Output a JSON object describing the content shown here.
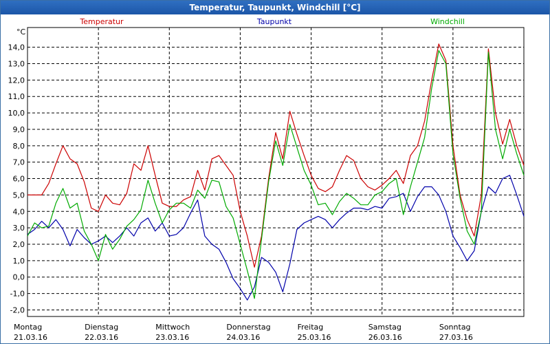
{
  "window": {
    "title": "Temperatur, Taupunkt, Windchill [°C]"
  },
  "chart_data": {
    "type": "line",
    "title": "Temperatur, Taupunkt, Windchill [°C]",
    "ylabel": "°C",
    "ylim": [
      -2.4,
      15.2
    ],
    "yticks": [
      -2.0,
      -1.0,
      0.0,
      1.0,
      2.0,
      3.0,
      4.0,
      5.0,
      6.0,
      7.0,
      8.0,
      9.0,
      10.0,
      11.0,
      12.0,
      13.0,
      14.0
    ],
    "ytick_labels": [
      "-2,0",
      "-1,0",
      "0,0",
      "1,0",
      "2,0",
      "3,0",
      "4,0",
      "5,0",
      "6,0",
      "7,0",
      "8,0",
      "9,0",
      "10,0",
      "11,0",
      "12,0",
      "13,0",
      "14,0"
    ],
    "xlim": [
      0,
      7
    ],
    "x_ticks": [
      {
        "day": "Montag",
        "date": "21.03.16"
      },
      {
        "day": "Dienstag",
        "date": "22.03.16"
      },
      {
        "day": "Mittwoch",
        "date": "23.03.16"
      },
      {
        "day": "Donnerstag",
        "date": "24.03.16"
      },
      {
        "day": "Freitag",
        "date": "25.03.16"
      },
      {
        "day": "Samstag",
        "date": "26.03.16"
      },
      {
        "day": "Sonntag",
        "date": "27.03.16"
      }
    ],
    "grid": true,
    "legend_position": "top",
    "series": [
      {
        "name": "Temperatur",
        "color": "#cc0000",
        "points": [
          [
            0.0,
            5.0
          ],
          [
            0.1,
            5.0
          ],
          [
            0.2,
            5.0
          ],
          [
            0.3,
            5.7
          ],
          [
            0.4,
            6.9
          ],
          [
            0.5,
            8.0
          ],
          [
            0.6,
            7.2
          ],
          [
            0.7,
            6.9
          ],
          [
            0.8,
            5.8
          ],
          [
            0.9,
            4.2
          ],
          [
            1.0,
            4.0
          ],
          [
            1.1,
            5.0
          ],
          [
            1.2,
            4.5
          ],
          [
            1.3,
            4.4
          ],
          [
            1.4,
            5.1
          ],
          [
            1.5,
            6.9
          ],
          [
            1.6,
            6.5
          ],
          [
            1.7,
            8.0
          ],
          [
            1.8,
            6.2
          ],
          [
            1.9,
            4.5
          ],
          [
            2.0,
            4.3
          ],
          [
            2.1,
            4.3
          ],
          [
            2.2,
            4.7
          ],
          [
            2.3,
            4.9
          ],
          [
            2.4,
            6.5
          ],
          [
            2.5,
            5.3
          ],
          [
            2.6,
            7.2
          ],
          [
            2.7,
            7.4
          ],
          [
            2.8,
            6.8
          ],
          [
            2.9,
            6.2
          ],
          [
            3.0,
            4.0
          ],
          [
            3.1,
            2.5
          ],
          [
            3.2,
            0.6
          ],
          [
            3.3,
            2.5
          ],
          [
            3.4,
            6.0
          ],
          [
            3.5,
            8.8
          ],
          [
            3.6,
            7.2
          ],
          [
            3.7,
            10.1
          ],
          [
            3.8,
            8.7
          ],
          [
            3.9,
            7.4
          ],
          [
            4.0,
            6.2
          ],
          [
            4.1,
            5.4
          ],
          [
            4.2,
            5.2
          ],
          [
            4.3,
            5.5
          ],
          [
            4.4,
            6.5
          ],
          [
            4.5,
            7.4
          ],
          [
            4.6,
            7.1
          ],
          [
            4.7,
            6.0
          ],
          [
            4.8,
            5.5
          ],
          [
            4.9,
            5.3
          ],
          [
            5.0,
            5.6
          ],
          [
            5.1,
            6.0
          ],
          [
            5.2,
            6.5
          ],
          [
            5.3,
            5.7
          ],
          [
            5.4,
            7.4
          ],
          [
            5.5,
            8.0
          ],
          [
            5.6,
            9.5
          ],
          [
            5.7,
            12.0
          ],
          [
            5.8,
            14.2
          ],
          [
            5.9,
            13.2
          ],
          [
            6.0,
            8.0
          ],
          [
            6.1,
            5.0
          ],
          [
            6.2,
            3.5
          ],
          [
            6.3,
            2.5
          ],
          [
            6.4,
            5.0
          ],
          [
            6.5,
            13.9
          ],
          [
            6.6,
            10.0
          ],
          [
            6.7,
            8.1
          ],
          [
            6.8,
            9.6
          ],
          [
            6.9,
            8.0
          ],
          [
            7.0,
            6.8
          ]
        ]
      },
      {
        "name": "Taupunkt",
        "color": "#0000aa",
        "points": [
          [
            0.0,
            2.6
          ],
          [
            0.1,
            2.9
          ],
          [
            0.2,
            3.4
          ],
          [
            0.3,
            3.0
          ],
          [
            0.4,
            3.5
          ],
          [
            0.5,
            2.9
          ],
          [
            0.6,
            1.9
          ],
          [
            0.7,
            2.9
          ],
          [
            0.8,
            2.4
          ],
          [
            0.9,
            2.0
          ],
          [
            1.0,
            2.2
          ],
          [
            1.1,
            2.5
          ],
          [
            1.2,
            2.1
          ],
          [
            1.3,
            2.5
          ],
          [
            1.4,
            3.0
          ],
          [
            1.5,
            2.5
          ],
          [
            1.6,
            3.3
          ],
          [
            1.7,
            3.6
          ],
          [
            1.8,
            2.8
          ],
          [
            1.9,
            3.3
          ],
          [
            2.0,
            2.5
          ],
          [
            2.1,
            2.6
          ],
          [
            2.2,
            3.0
          ],
          [
            2.3,
            3.9
          ],
          [
            2.4,
            4.7
          ],
          [
            2.5,
            2.5
          ],
          [
            2.6,
            2.0
          ],
          [
            2.7,
            1.7
          ],
          [
            2.8,
            0.9
          ],
          [
            2.9,
            -0.1
          ],
          [
            3.0,
            -0.7
          ],
          [
            3.1,
            -1.4
          ],
          [
            3.2,
            -0.6
          ],
          [
            3.3,
            1.2
          ],
          [
            3.4,
            0.9
          ],
          [
            3.5,
            0.3
          ],
          [
            3.6,
            -0.9
          ],
          [
            3.7,
            0.8
          ],
          [
            3.8,
            2.9
          ],
          [
            3.9,
            3.3
          ],
          [
            4.0,
            3.5
          ],
          [
            4.1,
            3.7
          ],
          [
            4.2,
            3.5
          ],
          [
            4.3,
            3.0
          ],
          [
            4.4,
            3.5
          ],
          [
            4.5,
            3.9
          ],
          [
            4.6,
            4.2
          ],
          [
            4.7,
            4.2
          ],
          [
            4.8,
            4.1
          ],
          [
            4.9,
            4.3
          ],
          [
            5.0,
            4.2
          ],
          [
            5.1,
            4.8
          ],
          [
            5.2,
            4.9
          ],
          [
            5.3,
            5.1
          ],
          [
            5.4,
            4.0
          ],
          [
            5.5,
            4.9
          ],
          [
            5.6,
            5.5
          ],
          [
            5.7,
            5.5
          ],
          [
            5.8,
            5.0
          ],
          [
            5.9,
            4.0
          ],
          [
            6.0,
            2.5
          ],
          [
            6.1,
            1.8
          ],
          [
            6.2,
            1.0
          ],
          [
            6.3,
            1.6
          ],
          [
            6.4,
            4.0
          ],
          [
            6.5,
            5.5
          ],
          [
            6.6,
            5.1
          ],
          [
            6.7,
            6.0
          ],
          [
            6.8,
            6.2
          ],
          [
            6.9,
            5.0
          ],
          [
            7.0,
            3.7
          ]
        ]
      },
      {
        "name": "Windchill",
        "color": "#00aa00",
        "points": [
          [
            0.0,
            2.5
          ],
          [
            0.1,
            3.3
          ],
          [
            0.2,
            3.0
          ],
          [
            0.3,
            3.1
          ],
          [
            0.4,
            4.5
          ],
          [
            0.5,
            5.4
          ],
          [
            0.6,
            4.2
          ],
          [
            0.7,
            4.5
          ],
          [
            0.8,
            2.8
          ],
          [
            0.9,
            2.0
          ],
          [
            1.0,
            1.0
          ],
          [
            1.1,
            2.6
          ],
          [
            1.2,
            1.7
          ],
          [
            1.3,
            2.3
          ],
          [
            1.4,
            3.1
          ],
          [
            1.5,
            3.5
          ],
          [
            1.6,
            4.1
          ],
          [
            1.7,
            5.9
          ],
          [
            1.8,
            4.5
          ],
          [
            1.9,
            3.3
          ],
          [
            2.0,
            4.1
          ],
          [
            2.1,
            4.5
          ],
          [
            2.2,
            4.5
          ],
          [
            2.3,
            4.2
          ],
          [
            2.4,
            5.3
          ],
          [
            2.5,
            4.8
          ],
          [
            2.6,
            5.9
          ],
          [
            2.7,
            5.8
          ],
          [
            2.8,
            4.3
          ],
          [
            2.9,
            3.6
          ],
          [
            3.0,
            2.0
          ],
          [
            3.1,
            0.4
          ],
          [
            3.2,
            -1.3
          ],
          [
            3.3,
            2.3
          ],
          [
            3.4,
            5.8
          ],
          [
            3.5,
            8.3
          ],
          [
            3.6,
            6.8
          ],
          [
            3.7,
            9.3
          ],
          [
            3.8,
            7.9
          ],
          [
            3.9,
            6.5
          ],
          [
            4.0,
            5.6
          ],
          [
            4.1,
            4.4
          ],
          [
            4.2,
            4.5
          ],
          [
            4.3,
            3.8
          ],
          [
            4.4,
            4.6
          ],
          [
            4.5,
            5.1
          ],
          [
            4.6,
            4.8
          ],
          [
            4.7,
            4.4
          ],
          [
            4.8,
            4.4
          ],
          [
            4.9,
            5.0
          ],
          [
            5.0,
            5.2
          ],
          [
            5.1,
            5.7
          ],
          [
            5.2,
            6.0
          ],
          [
            5.3,
            3.8
          ],
          [
            5.4,
            5.5
          ],
          [
            5.5,
            7.0
          ],
          [
            5.6,
            8.5
          ],
          [
            5.7,
            11.5
          ],
          [
            5.8,
            13.8
          ],
          [
            5.9,
            13.0
          ],
          [
            6.0,
            7.5
          ],
          [
            6.1,
            4.8
          ],
          [
            6.2,
            2.8
          ],
          [
            6.3,
            2.0
          ],
          [
            6.4,
            4.0
          ],
          [
            6.5,
            13.7
          ],
          [
            6.6,
            9.0
          ],
          [
            6.7,
            7.2
          ],
          [
            6.8,
            9.0
          ],
          [
            6.9,
            7.5
          ],
          [
            7.0,
            6.2
          ]
        ]
      }
    ]
  }
}
